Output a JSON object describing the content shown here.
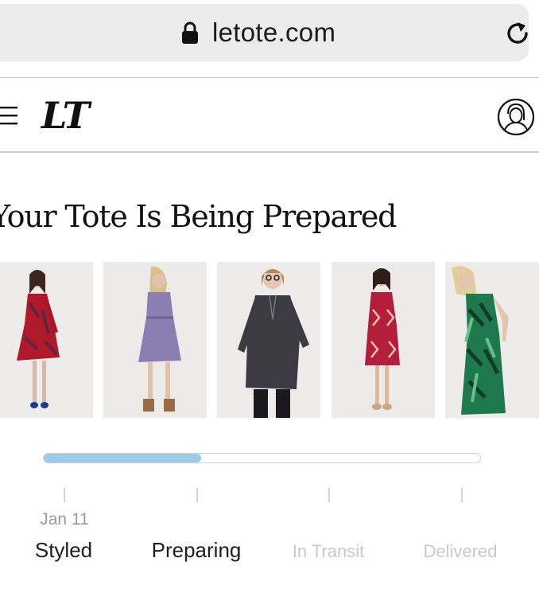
{
  "browser": {
    "url": "letote.com",
    "lock_icon": "lock-icon",
    "reload_icon": "reload-icon"
  },
  "header": {
    "menu_icon": "hamburger-menu-icon",
    "logo_text": "LT",
    "account_icon": "user-account-icon"
  },
  "main": {
    "title": "Your Tote Is Being Prepared",
    "products": [
      {
        "name": "red-floral-dress",
        "color": "#b0182c"
      },
      {
        "name": "purple-paisley-dress",
        "color": "#8a7fb3"
      },
      {
        "name": "charcoal-lace-up-top",
        "color": "#3c3a42"
      },
      {
        "name": "red-geometric-dress",
        "color": "#b21e3c"
      },
      {
        "name": "green-palm-dress",
        "color": "#1e7a4e"
      }
    ],
    "progress": {
      "fill_fraction": 0.36,
      "fill_color": "#9dcbe8",
      "steps": [
        {
          "date": "Jan 11",
          "label": "Styled",
          "state": "complete"
        },
        {
          "date": "",
          "label": "Preparing",
          "state": "current"
        },
        {
          "date": "",
          "label": "In Transit",
          "state": "pending"
        },
        {
          "date": "",
          "label": "Delivered",
          "state": "pending"
        }
      ]
    }
  }
}
